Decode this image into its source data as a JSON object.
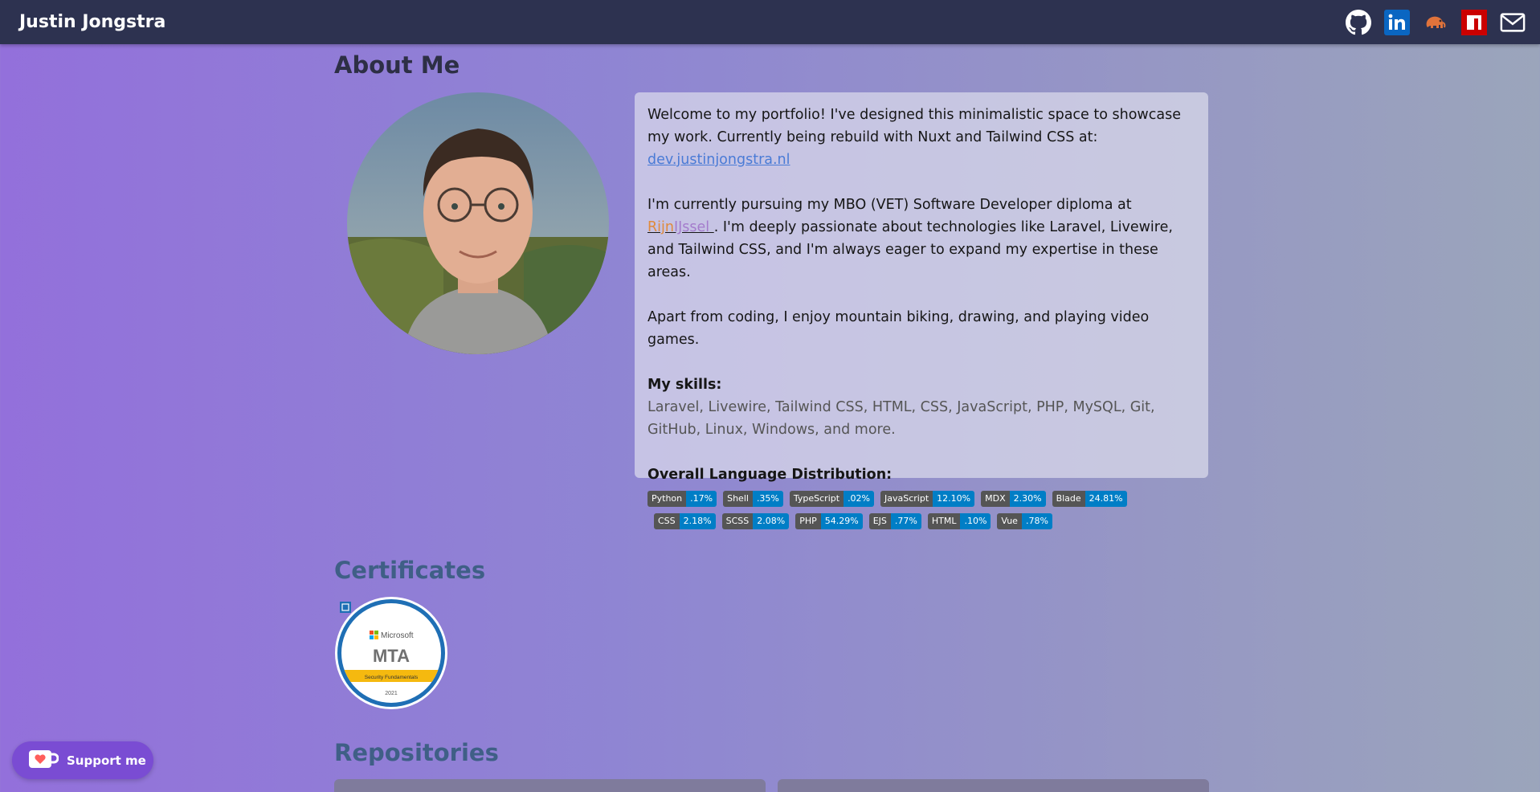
{
  "header": {
    "brand": "Justin Jongstra",
    "links": [
      {
        "name": "github-icon",
        "color": "#ffffff"
      },
      {
        "name": "linkedin-icon",
        "color": "#0a66c2"
      },
      {
        "name": "gitea-elephant-icon",
        "color": "#e0733b"
      },
      {
        "name": "npm-icon",
        "color": "#cb0000"
      },
      {
        "name": "mail-icon",
        "color": "#ffffff"
      }
    ]
  },
  "about": {
    "title": "About Me",
    "intro_line": "Welcome to my portfolio! I've designed this minimalistic space to showcase my work. Currently being rebuild with Nuxt and Tailwind CSS at: ",
    "dev_link": "dev.justinjongstra.nl",
    "study_before": "I'm currently pursuing my MBO (VET) Software Developer diploma at ",
    "school_part1": "Rijn",
    "school_part2": "IJssel ",
    "study_after": ". I'm deeply passionate about technologies like Laravel, Livewire, and Tailwind CSS, and I'm always eager to expand my expertise in these areas.",
    "hobbies": "Apart from coding, I enjoy mountain biking, drawing, and playing video games.",
    "skills_title": "My skills:",
    "skills": "Laravel, Livewire, Tailwind CSS, HTML, CSS, JavaScript, PHP, MySQL, Git, GitHub, Linux, Windows, and more.",
    "languages_title": "Overall Language Distribution:",
    "languages_row1": [
      {
        "label": "Python",
        "value": ".17%"
      },
      {
        "label": "Shell",
        "value": ".35%"
      },
      {
        "label": "TypeScript",
        "value": ".02%"
      },
      {
        "label": "JavaScript",
        "value": "12.10%"
      },
      {
        "label": "MDX",
        "value": "2.30%"
      },
      {
        "label": "Blade",
        "value": "24.81%"
      }
    ],
    "languages_row2": [
      {
        "label": "CSS",
        "value": "2.18%"
      },
      {
        "label": "SCSS",
        "value": "2.08%"
      },
      {
        "label": "PHP",
        "value": "54.29%"
      },
      {
        "label": "EJS",
        "value": ".77%"
      },
      {
        "label": "HTML",
        "value": ".10%"
      },
      {
        "label": "Vue",
        "value": ".78%"
      }
    ]
  },
  "certificates": {
    "title": "Certificates",
    "badge": {
      "brand": "Microsoft",
      "name": "MTA",
      "subtitle": "Security Fundamentals",
      "year": "2021"
    }
  },
  "repositories": {
    "title": "Repositories"
  },
  "support": {
    "label": "Support me"
  },
  "colors": {
    "header_bg": "#2d3250",
    "accent": "#7a4cd3",
    "badge_label": "#555555",
    "badge_value": "#007ec6"
  }
}
